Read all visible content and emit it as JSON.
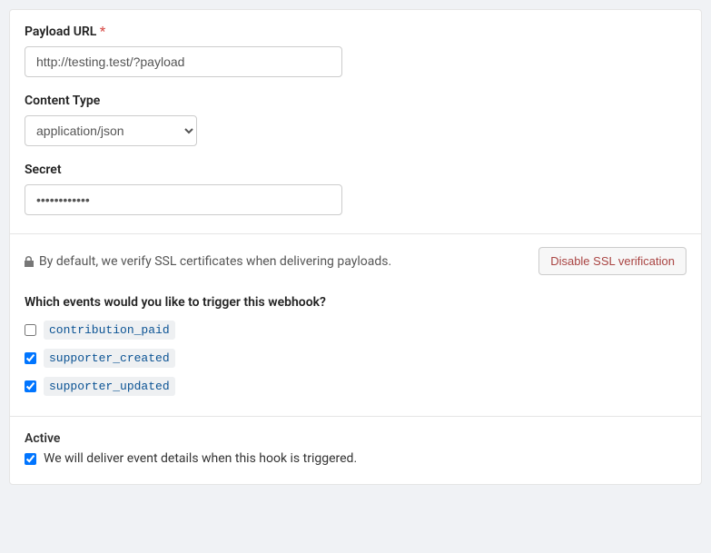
{
  "payload_url": {
    "label": "Payload URL",
    "required": "*",
    "value": "http://testing.test/?payload"
  },
  "content_type": {
    "label": "Content Type",
    "value": "application/json"
  },
  "secret": {
    "label": "Secret",
    "value": "••••••••••••"
  },
  "ssl": {
    "description": "By default, we verify SSL certificates when delivering payloads.",
    "button": "Disable SSL verification"
  },
  "events": {
    "heading": "Which events would you like to trigger this webhook?",
    "items": [
      {
        "name": "contribution_paid",
        "checked": false
      },
      {
        "name": "supporter_created",
        "checked": true
      },
      {
        "name": "supporter_updated",
        "checked": true
      }
    ]
  },
  "active": {
    "label": "Active",
    "description": "We will deliver event details when this hook is triggered.",
    "checked": true
  }
}
